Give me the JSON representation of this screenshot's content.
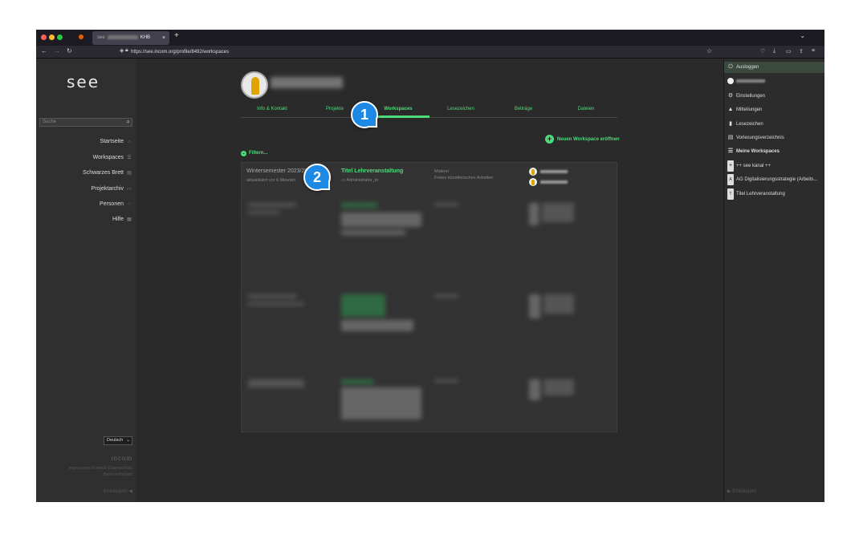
{
  "browser": {
    "tab_title": "KHB",
    "tab_close": "×",
    "new_tab": "+",
    "tab_list": "⌄",
    "back": "←",
    "forward": "→",
    "reload": "↻",
    "url": "https://see.incom.org/profile/8492/workspaces",
    "bookmark": "☆"
  },
  "left": {
    "logo": "see",
    "search_placeholder": "Suche",
    "nav": [
      {
        "label": "Startseite",
        "icon": "home-icon",
        "glyph": "⌂"
      },
      {
        "label": "Workspaces",
        "icon": "list-icon",
        "glyph": "☰"
      },
      {
        "label": "Schwarzes Brett",
        "icon": "board-icon",
        "glyph": "▤"
      },
      {
        "label": "Projektarchiv",
        "icon": "archive-icon",
        "glyph": "▭"
      },
      {
        "label": "Personen",
        "icon": "people-icon",
        "glyph": "⁘"
      },
      {
        "label": "Hilfe",
        "icon": "help-icon",
        "glyph": "▦"
      }
    ],
    "language": "Deutsch",
    "brand": "ıncom",
    "footer_line1": "Impressum Kontakt Datenschutz",
    "footer_line2": "Barrierefreiheit",
    "collapse": "Einklappen"
  },
  "profile": {
    "tabs": [
      "Info & Kontakt",
      "Projekte",
      "Workspaces",
      "Lesezeichen",
      "Beiträge",
      "Dateien"
    ],
    "active_tab": "Workspaces",
    "new_workspace": "Neuen Workspace eröffnen",
    "filter": "Filtern..."
  },
  "workspace": {
    "semester": "Wintersemester 2023/2024",
    "updated": "aktualisiert vor 6 Minuten",
    "title": "Titel Lehrveranstaltung",
    "role": "Administrator_in",
    "category": "Malerei",
    "subcategory": "Freies künstlerisches Arbeiten"
  },
  "badges": [
    "1",
    "2"
  ],
  "right": {
    "items": [
      {
        "label": "Ausloggen",
        "glyph": "⏻",
        "icon": "power-icon"
      },
      {
        "label": "",
        "glyph": "",
        "icon": "avatar-icon"
      },
      {
        "label": "Einstellungen",
        "glyph": "⚙",
        "icon": "gear-icon"
      },
      {
        "label": "Mitteilungen",
        "glyph": "▲",
        "icon": "bell-icon"
      },
      {
        "label": "Lesezeichen",
        "glyph": "▮",
        "icon": "bookmark-icon"
      },
      {
        "label": "Vorlesungsverzeichnis",
        "glyph": "▤",
        "icon": "catalog-icon"
      },
      {
        "label": "Meine Workspaces",
        "glyph": "☰",
        "icon": "workspaces-icon"
      },
      {
        "label": "++ see kanal ++",
        "glyph": "+",
        "icon": "channel-icon"
      },
      {
        "label": "AG Digitalisierungsstrategie (Arbeits...",
        "glyph": "A",
        "icon": "ag-icon"
      },
      {
        "label": "Titel Lehrveranstaltung",
        "glyph": "T",
        "icon": "course-icon"
      }
    ],
    "collapse": "Einklappen"
  },
  "colors": {
    "accent": "#4ddc7a",
    "badge": "#1e88e5"
  }
}
